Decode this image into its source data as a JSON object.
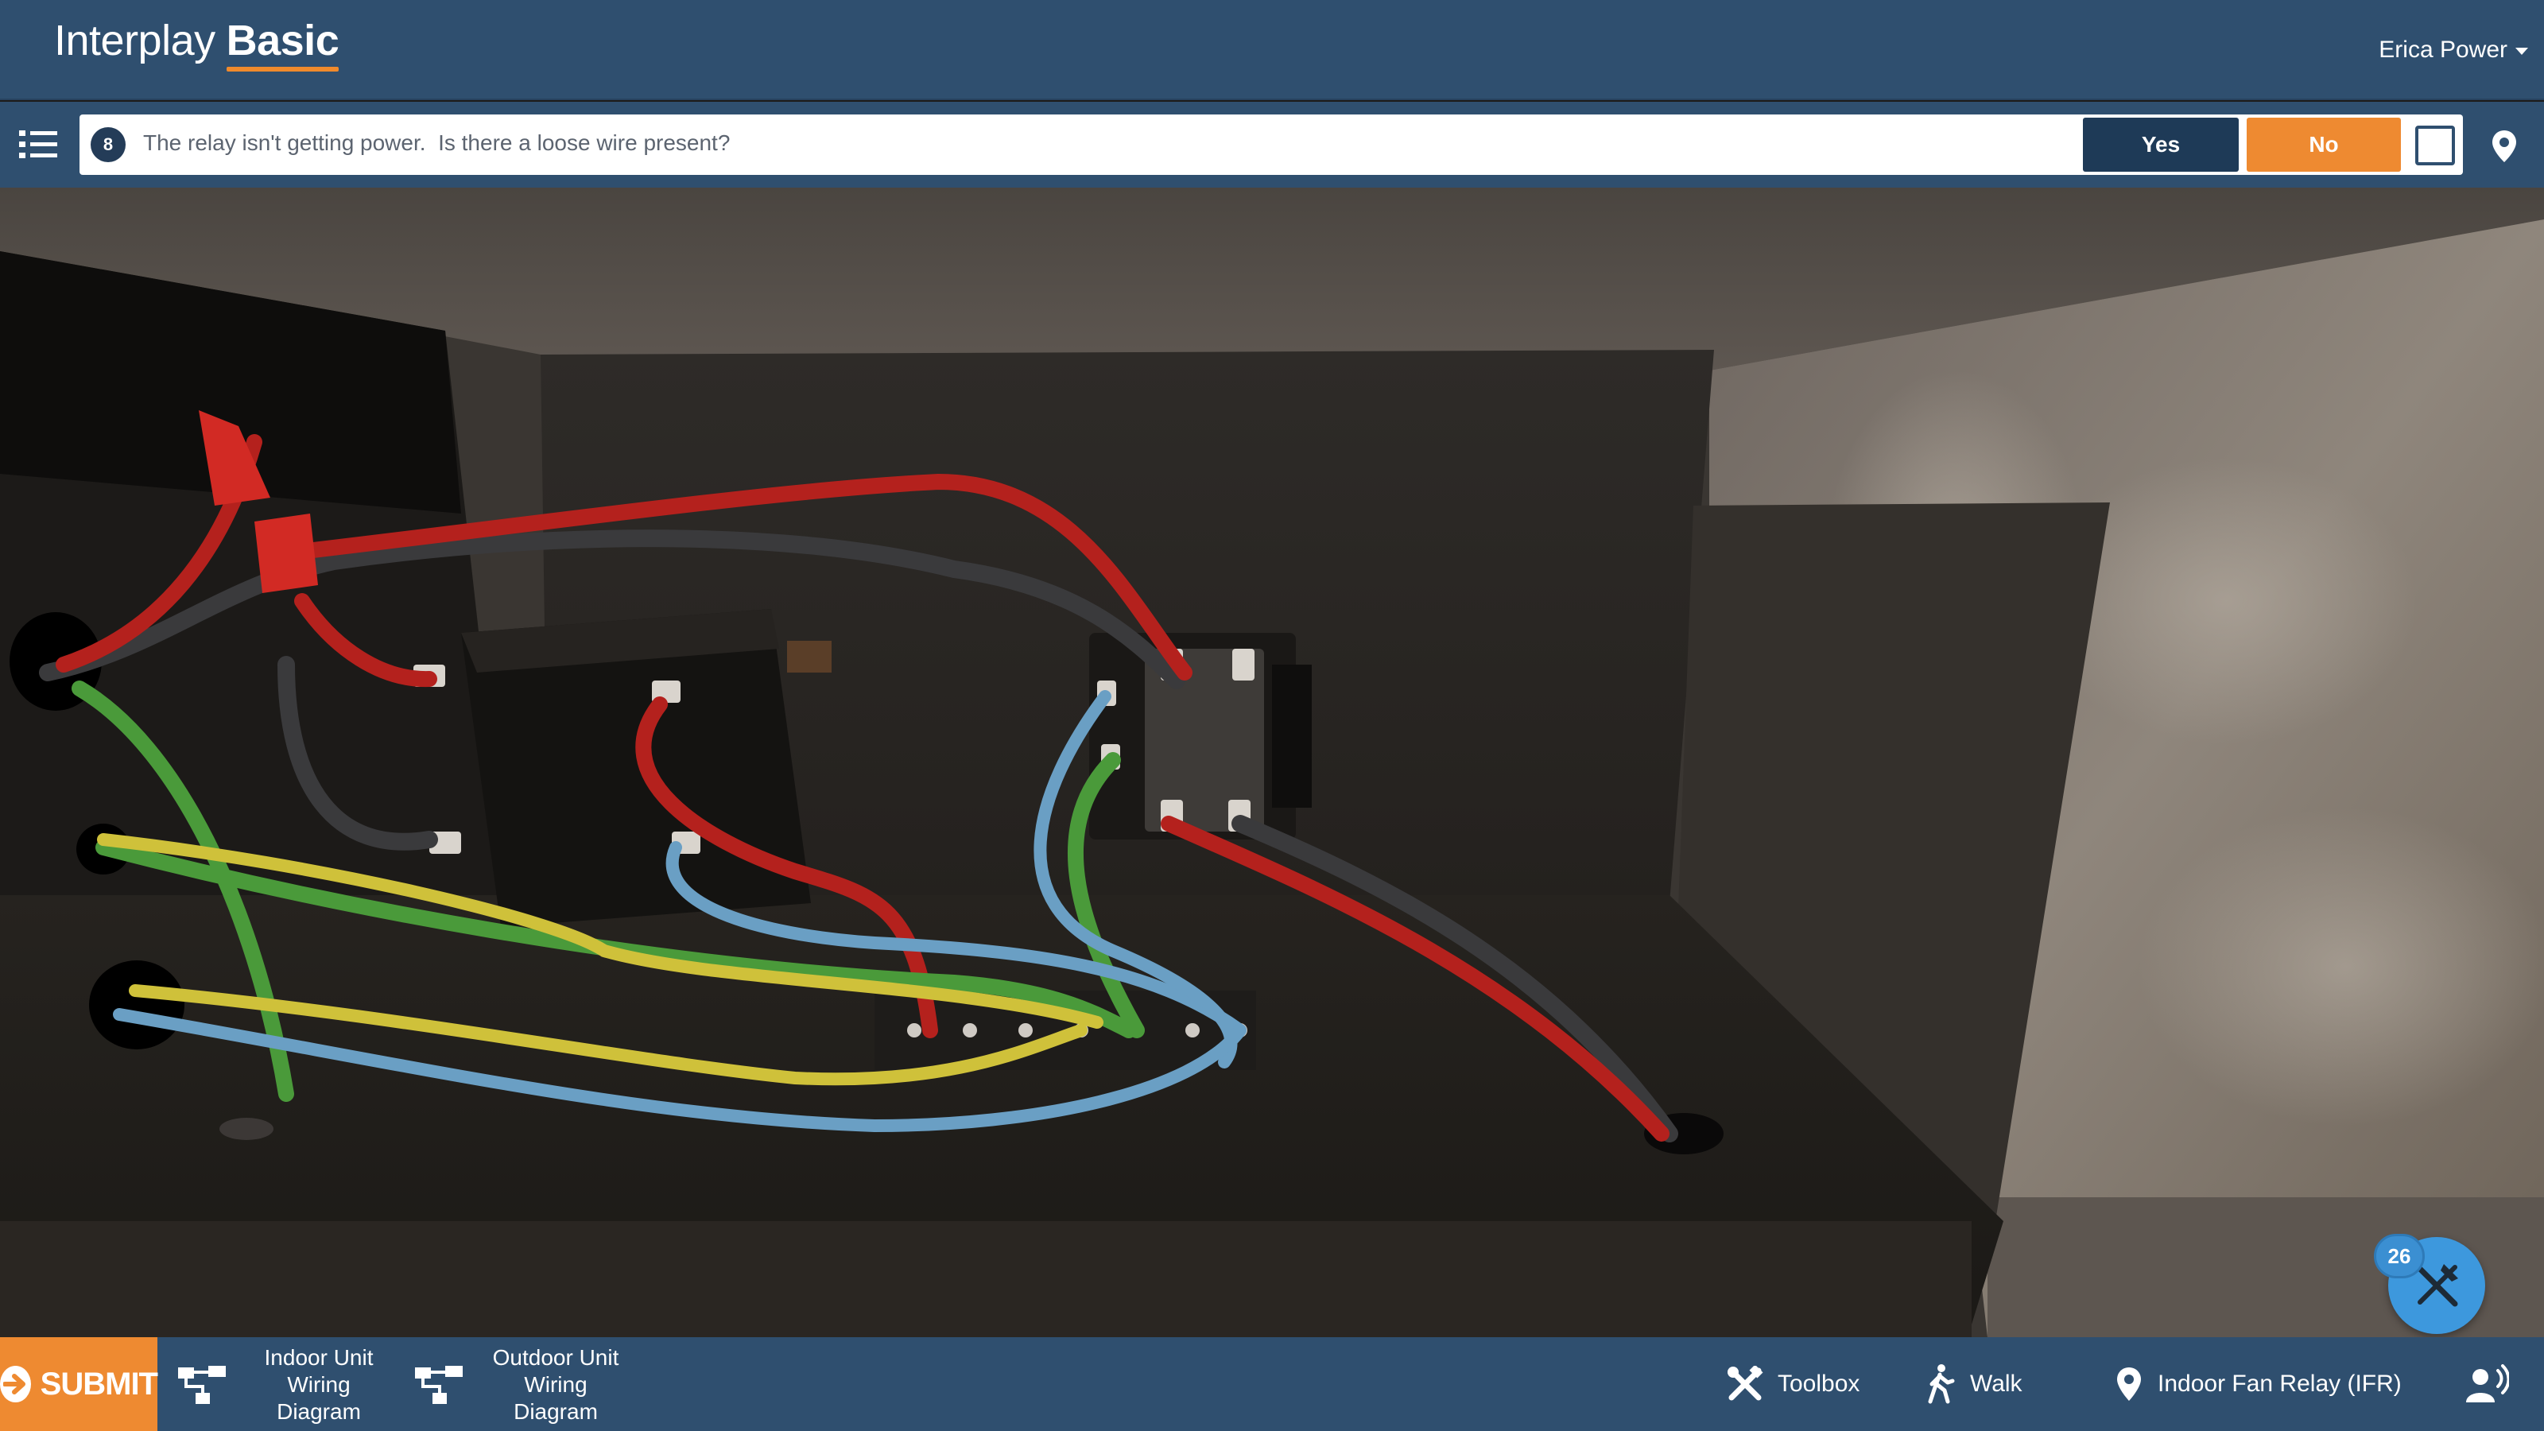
{
  "header": {
    "brand_light": "Interplay",
    "brand_bold": "Basic",
    "user_name": "Erica Power"
  },
  "question": {
    "number": "8",
    "text": "The relay isn't getting power.  Is there a loose wire present?",
    "yes_label": "Yes",
    "no_label": "No"
  },
  "tools": {
    "badge_count": "26"
  },
  "bottom_bar": {
    "submit_label": "SUBMIT",
    "indoor_diagram_label": "Indoor Unit Wiring Diagram",
    "outdoor_diagram_label": "Outdoor Unit Wiring Diagram",
    "toolbox_label": "Toolbox",
    "walk_label": "Walk",
    "location_label": "Indoor Fan Relay (IFR)"
  },
  "colors": {
    "header_bg": "#2f4f6f",
    "accent_orange": "#ee8a31",
    "navy": "#1e3a57",
    "fab_blue": "#3d98dd"
  },
  "icons": [
    "list-icon",
    "location-pin-icon",
    "tools-icon",
    "arrow-right-icon",
    "diagram-icon",
    "toolbox-icon",
    "walk-icon",
    "voice-icon"
  ]
}
